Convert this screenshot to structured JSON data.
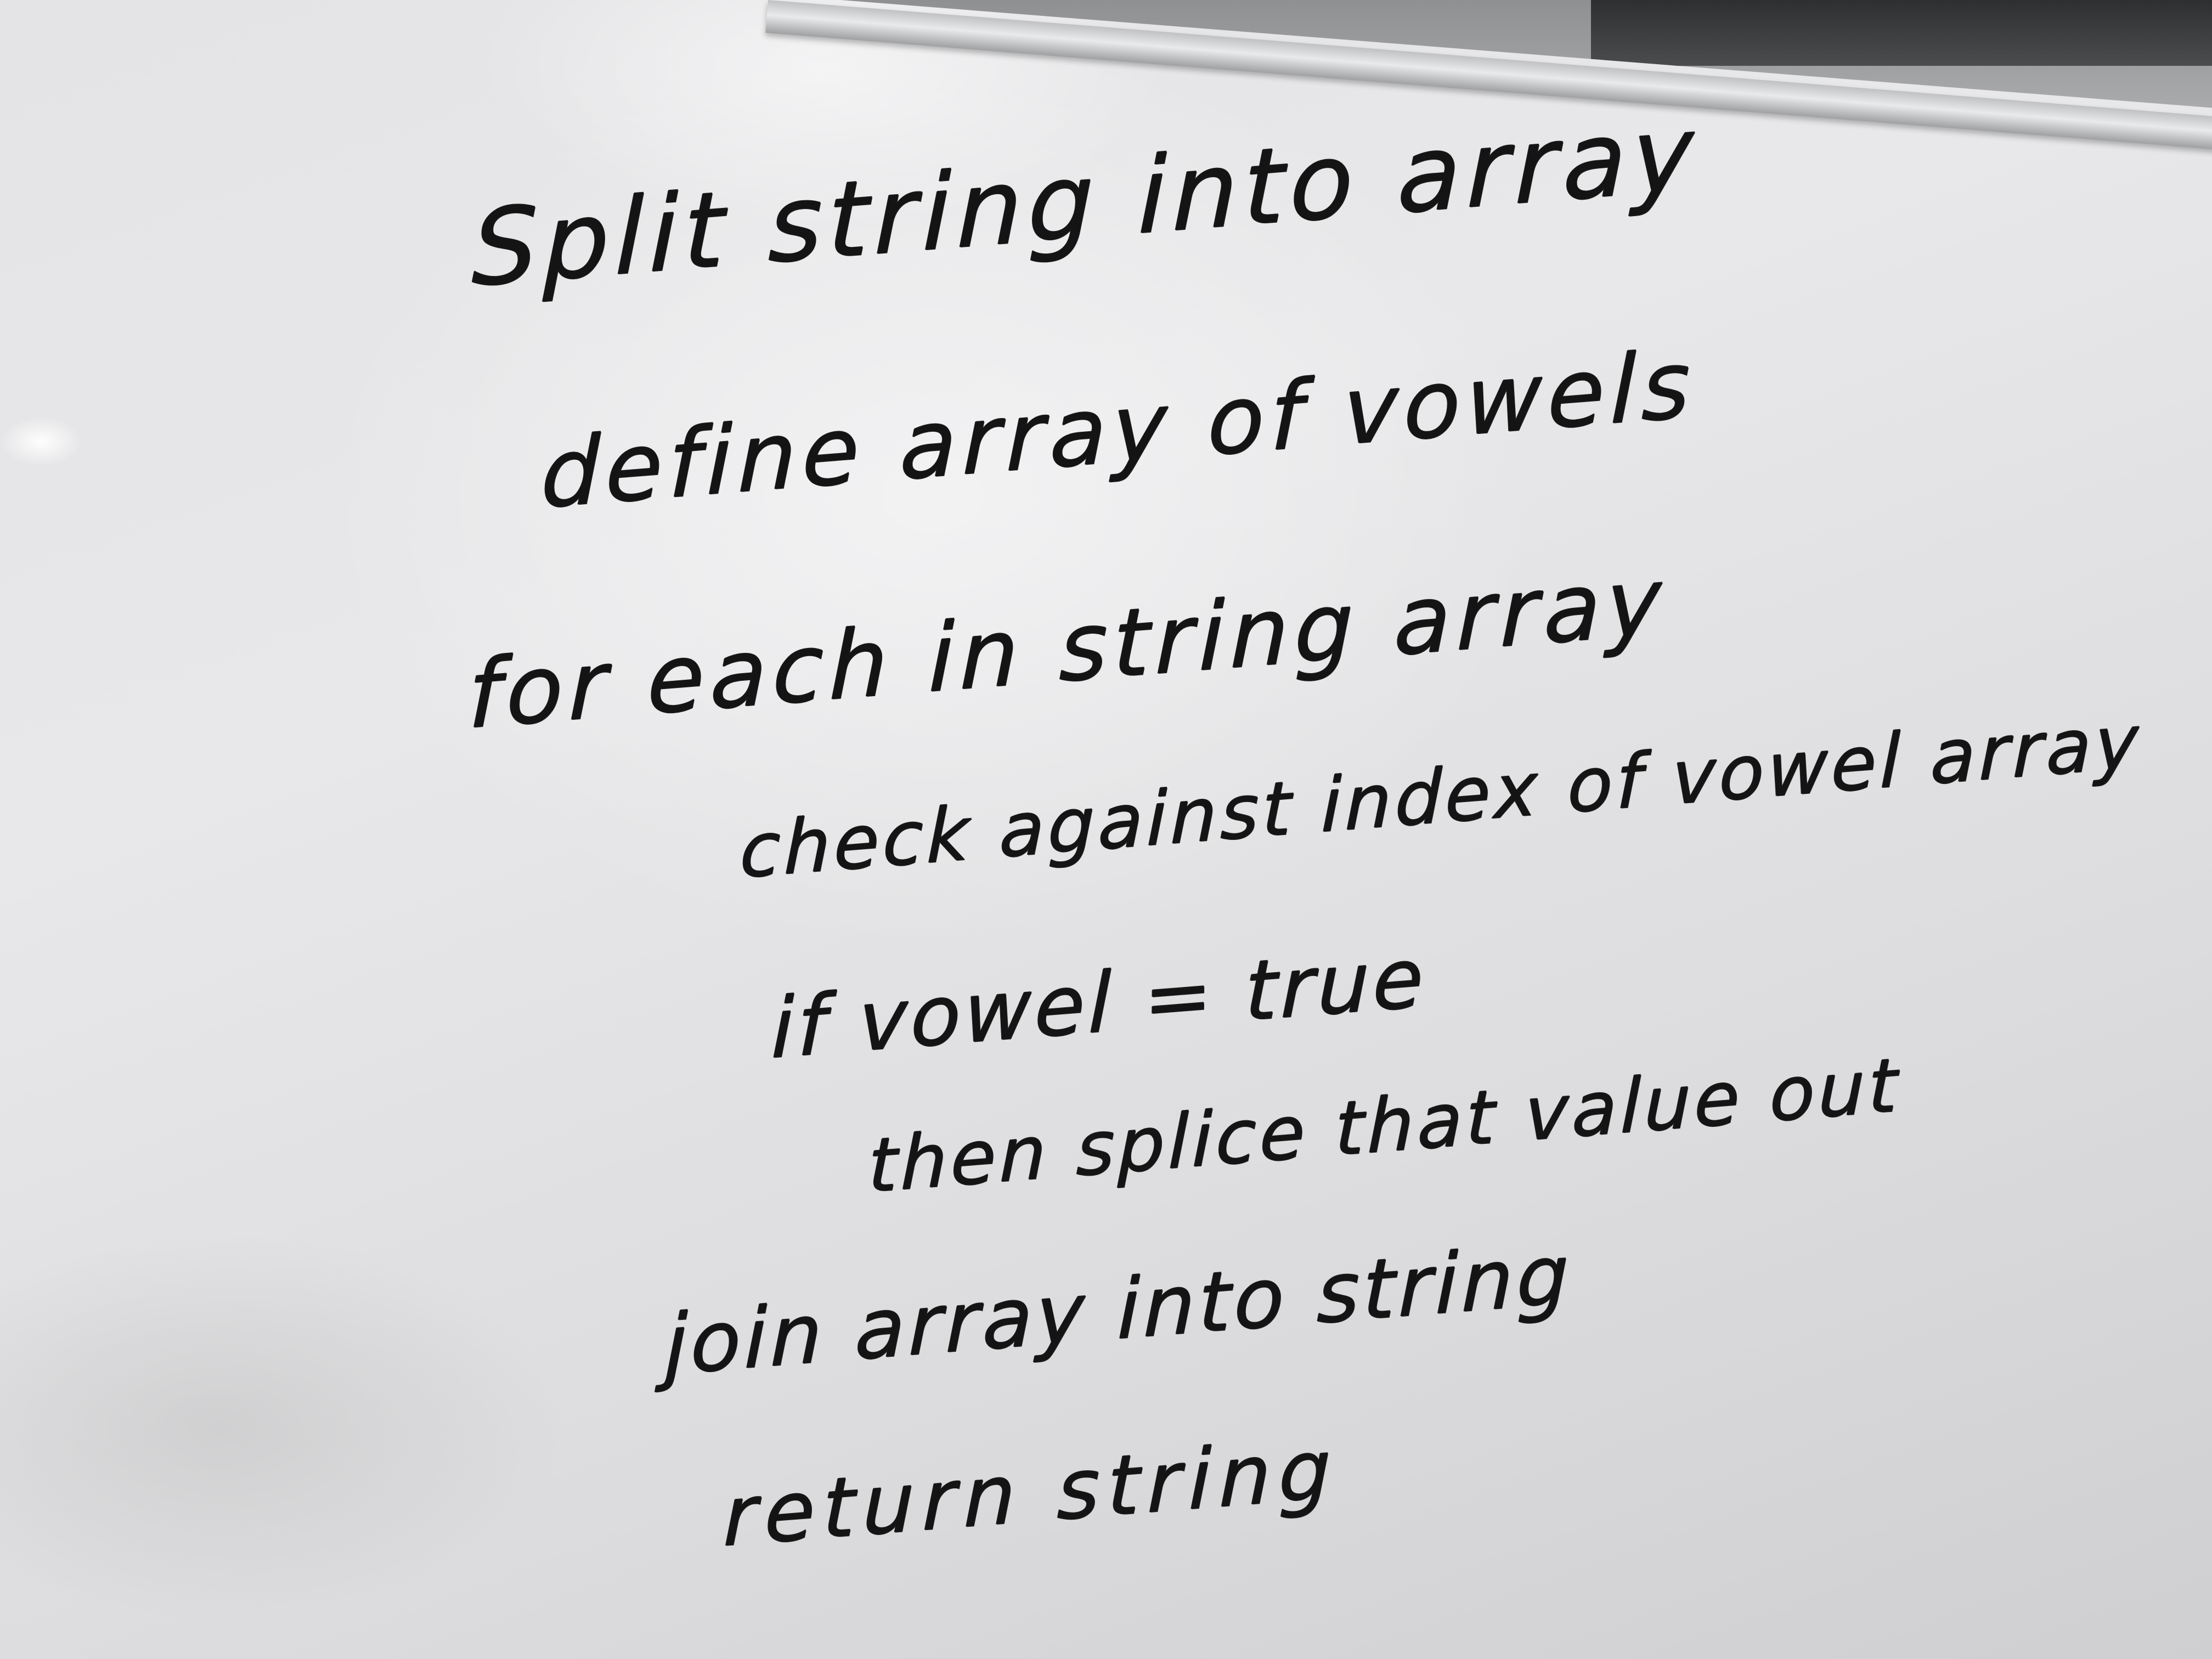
{
  "whiteboard": {
    "lines": [
      "Split string into array",
      "define array of vowels",
      "for each in string array",
      "check against index of vowel array",
      "if vowel = true",
      "then splice that value out",
      "join array into string",
      "return string"
    ]
  }
}
